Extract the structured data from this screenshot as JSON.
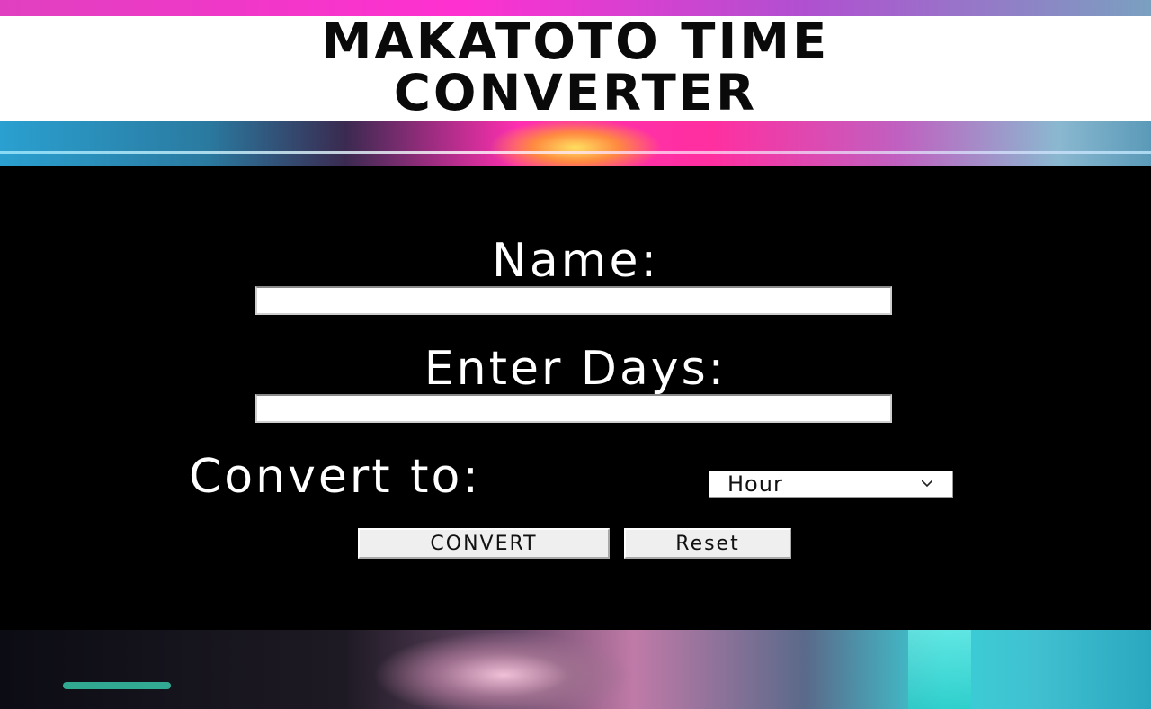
{
  "header": {
    "title": "MAKATOTO TIME CONVERTER"
  },
  "form": {
    "name_label": "Name:",
    "name_value": "",
    "days_label": "Enter Days:",
    "days_value": "",
    "convert_label": "Convert to:",
    "unit_selected": "Hour",
    "convert_button": "CONVERT",
    "reset_button": "Reset"
  },
  "colors": {
    "panel": "#000000",
    "title_band": "#ffffff",
    "accent_pink": "#ff2fb0",
    "accent_cyan": "#3ad0d8"
  },
  "icons": {
    "select_arrow": "chevron-down-icon"
  }
}
